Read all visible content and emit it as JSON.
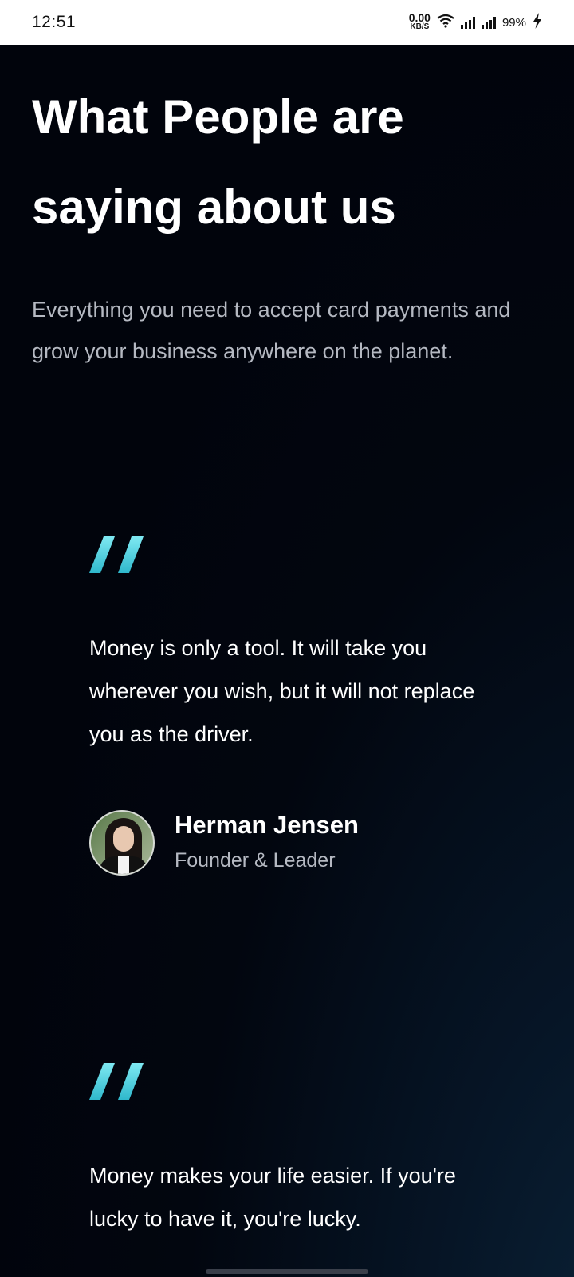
{
  "status_bar": {
    "time": "12:51",
    "net_speed_value": "0.00",
    "net_speed_unit": "KB/S",
    "battery": "99%",
    "icons": [
      "wifi-icon",
      "signal-icon",
      "signal-icon",
      "charging-icon"
    ]
  },
  "page": {
    "heading": "What People are saying about us",
    "subtext": "Everything you need to accept card payments and grow your business anywhere on the planet."
  },
  "testimonials": [
    {
      "quote": "Money is only a tool. It will take you wherever you wish, but it will not replace you as the driver.",
      "author_name": "Herman Jensen",
      "author_role": "Founder & Leader"
    },
    {
      "quote": "Money makes your life easier. If you're lucky to have it, you're lucky."
    }
  ],
  "colors": {
    "background": "#01040c",
    "accent_cyan": "#4fd8e6",
    "subtext": "#b5b9c2"
  }
}
